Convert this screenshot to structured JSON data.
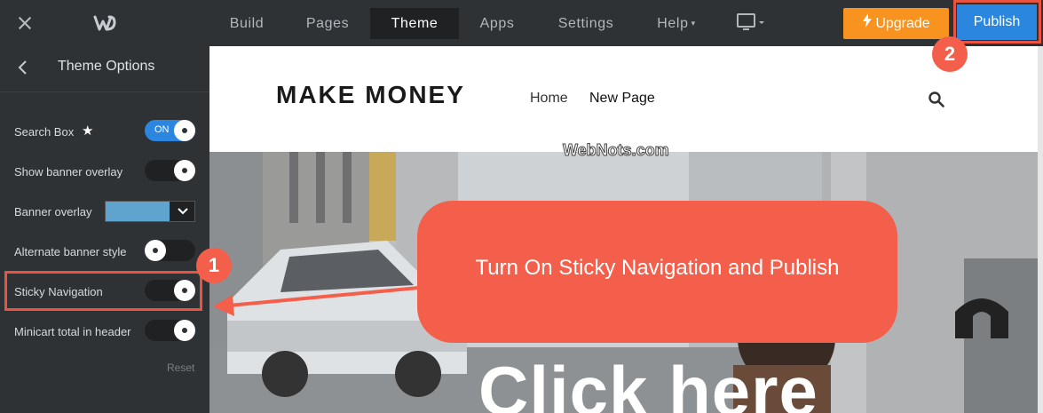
{
  "topbar": {
    "nav": [
      {
        "label": "Build"
      },
      {
        "label": "Pages"
      },
      {
        "label": "Theme"
      },
      {
        "label": "Apps"
      },
      {
        "label": "Settings"
      },
      {
        "label": "Help"
      }
    ],
    "upgrade_label": "Upgrade",
    "publish_label": "Publish"
  },
  "sidebar": {
    "title": "Theme Options",
    "options": [
      {
        "label": "Search Box",
        "toggle": "ON"
      },
      {
        "label": "Show banner overlay"
      },
      {
        "label": "Banner overlay",
        "color": "#5fa3cf"
      },
      {
        "label": "Alternate banner style"
      },
      {
        "label": "Sticky Navigation"
      },
      {
        "label": "Minicart total in header"
      }
    ],
    "reset_label": "Reset"
  },
  "preview": {
    "site_title": "MAKE MONEY",
    "nav": [
      "Home",
      "New Page"
    ],
    "watermark": "WebNots.com",
    "banner_text": "Click here"
  },
  "annotations": {
    "callout": "Turn On Sticky Navigation and Publish",
    "badge1": "1",
    "badge2": "2"
  },
  "colors": {
    "accent_red": "#f45f4c",
    "publish_blue": "#2b86e0",
    "upgrade_orange": "#f7931e"
  }
}
